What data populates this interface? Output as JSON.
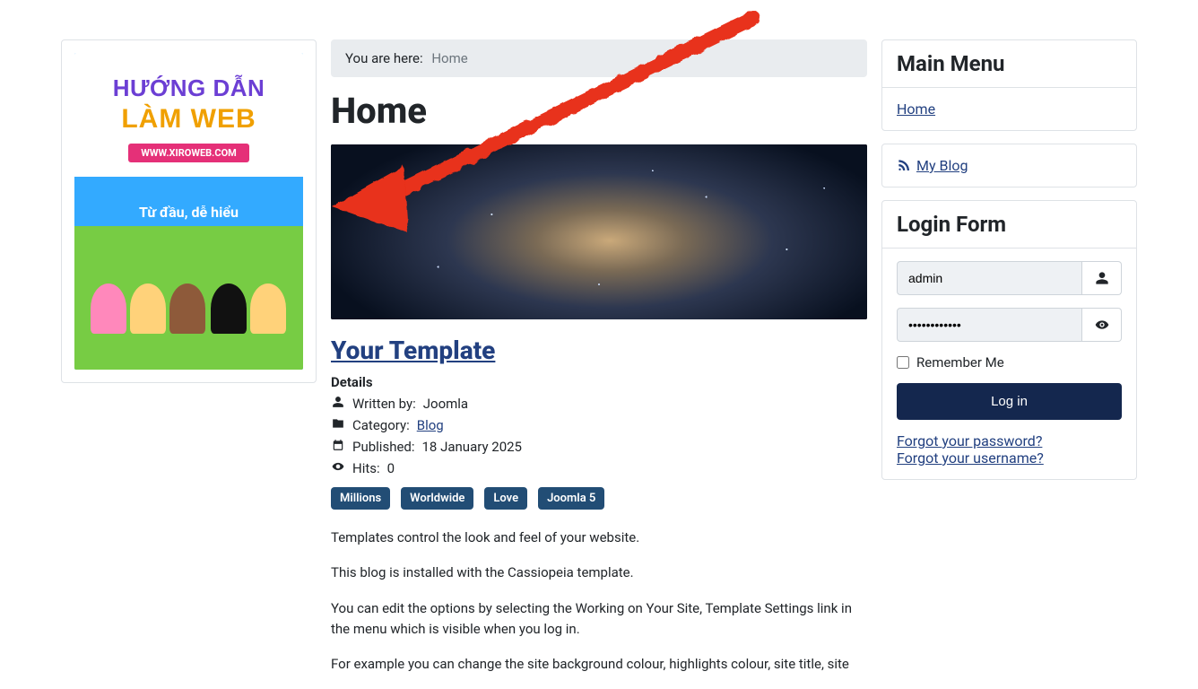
{
  "breadcrumb": {
    "label": "You are here:",
    "crumb": "Home"
  },
  "page": {
    "title": "Home"
  },
  "article": {
    "title": "Your Template",
    "details_label": "Details",
    "written_by_label": "Written by:",
    "author": "Joomla",
    "category_label": "Category:",
    "category": "Blog",
    "published_label": "Published:",
    "published": "18 January 2025",
    "hits_label": "Hits:",
    "hits": "0",
    "tags": [
      "Millions",
      "Worldwide",
      "Love",
      "Joomla 5"
    ],
    "paragraphs": [
      "Templates control the look and feel of your website.",
      "This blog is installed with the Cassiopeia template.",
      "You can edit the options by selecting the Working on Your Site, Template Settings link in the menu which is visible when you log in.",
      "For example you can change the site background colour, highlights colour, site title, site"
    ]
  },
  "left_banner": {
    "line1": "HƯỚNG DẪN",
    "line2": "LÀM WEB",
    "ribbon": "WWW.XIROWEB.COM",
    "tagline": "Từ đầu, dễ hiểu"
  },
  "main_menu": {
    "title": "Main Menu",
    "items": [
      "Home"
    ]
  },
  "blog_module": {
    "label": "My Blog"
  },
  "login": {
    "title": "Login Form",
    "username_value": "admin",
    "password_value": "••••••••••••",
    "remember_label": "Remember Me",
    "button": "Log in",
    "forgot_password": "Forgot your password?",
    "forgot_username": "Forgot your username?"
  }
}
